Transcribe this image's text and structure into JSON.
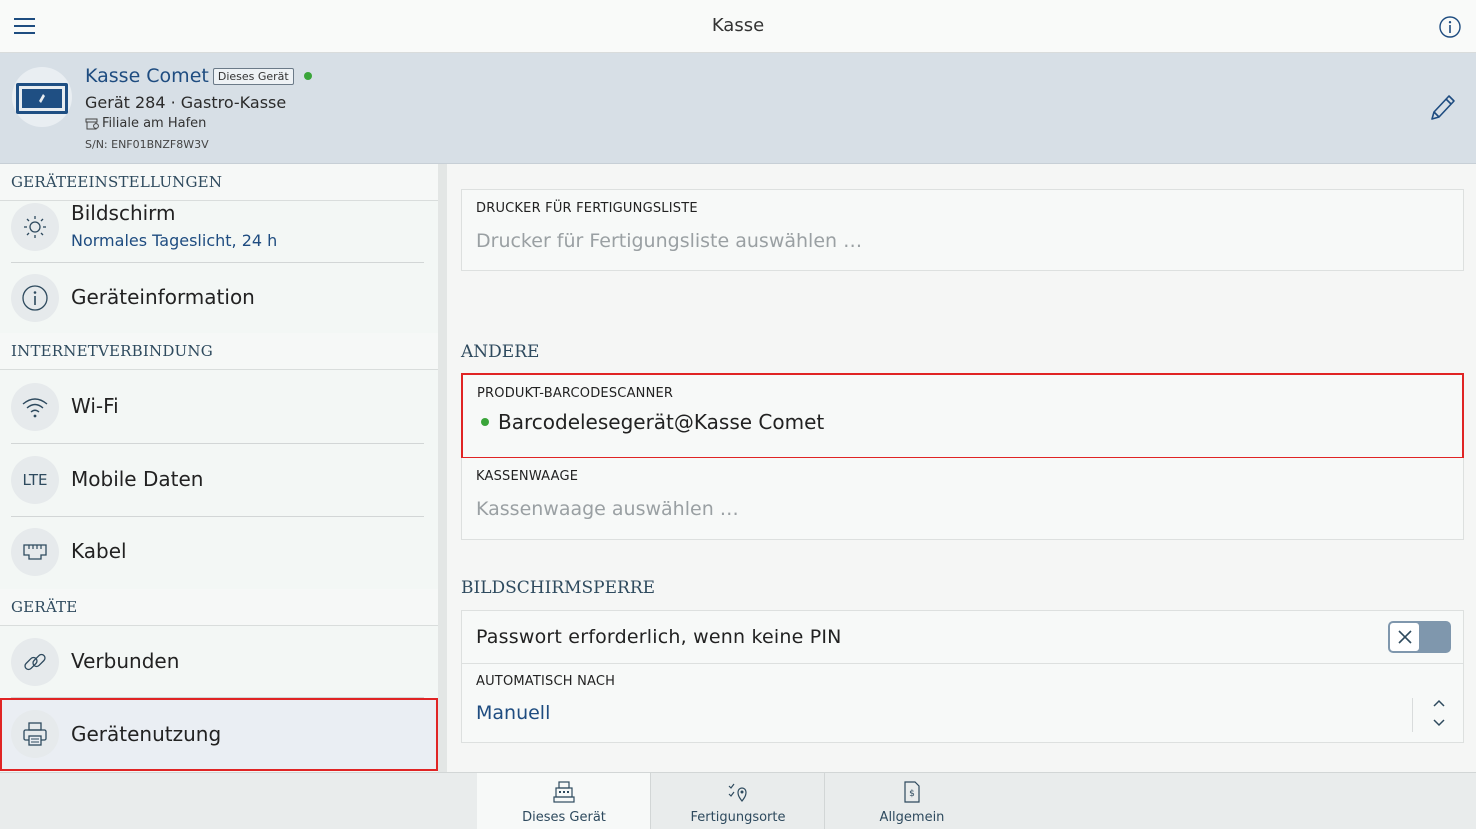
{
  "topbar": {
    "title": "Kasse"
  },
  "device": {
    "name": "Kasse Comet",
    "badge": "Dieses Gerät",
    "subtitle": "Gerät 284 · Gastro-Kasse",
    "location": "Filiale am Hafen",
    "serial": "S/N: ENF01BNZF8W3V",
    "status_color": "#3aa53a"
  },
  "sidebar": {
    "sections": {
      "device_settings": "GERÄTEEINSTELLUNGEN",
      "internet": "INTERNETVERBINDUNG",
      "devices": "GERÄTE"
    },
    "items": {
      "display": {
        "label": "Bildschirm",
        "sub": "Normales Tageslicht, 24 h",
        "icon": "sun-icon"
      },
      "device_info": {
        "label": "Geräteinformation",
        "icon": "info-icon"
      },
      "wifi": {
        "label": "Wi-Fi",
        "icon": "wifi-icon"
      },
      "mobile": {
        "label": "Mobile Daten",
        "icon_text": "LTE"
      },
      "cable": {
        "label": "Kabel",
        "icon": "ethernet-icon"
      },
      "connected": {
        "label": "Verbunden",
        "icon": "link-icon"
      },
      "usage": {
        "label": "Gerätenutzung",
        "icon": "printer-icon"
      }
    }
  },
  "main": {
    "printer": {
      "caption": "DRUCKER FÜR FERTIGUNGSLISTE",
      "placeholder": "Drucker für Fertigungsliste auswählen …"
    },
    "other_title": "ANDERE",
    "scanner": {
      "caption": "PRODUKT-BARCODESCANNER",
      "device": "Barcodelesegerät@Kasse Comet"
    },
    "scale": {
      "caption": "KASSENWAAGE",
      "placeholder": "Kassenwaage auswählen …"
    },
    "lock_title": "BILDSCHIRMSPERRE",
    "password": {
      "label": "Passwort erforderlich, wenn keine PIN",
      "enabled": false
    },
    "auto": {
      "caption": "AUTOMATISCH NACH",
      "value": "Manuell"
    }
  },
  "tabs": [
    {
      "label": "Dieses Gerät",
      "icon": "register-icon",
      "active": true
    },
    {
      "label": "Fertigungsorte",
      "icon": "checklist-location-icon",
      "active": false
    },
    {
      "label": "Allgemein",
      "icon": "document-dollar-icon",
      "active": false
    }
  ],
  "colors": {
    "accent": "#1e4c80",
    "highlight": "#e02424",
    "online": "#3aa53a"
  }
}
